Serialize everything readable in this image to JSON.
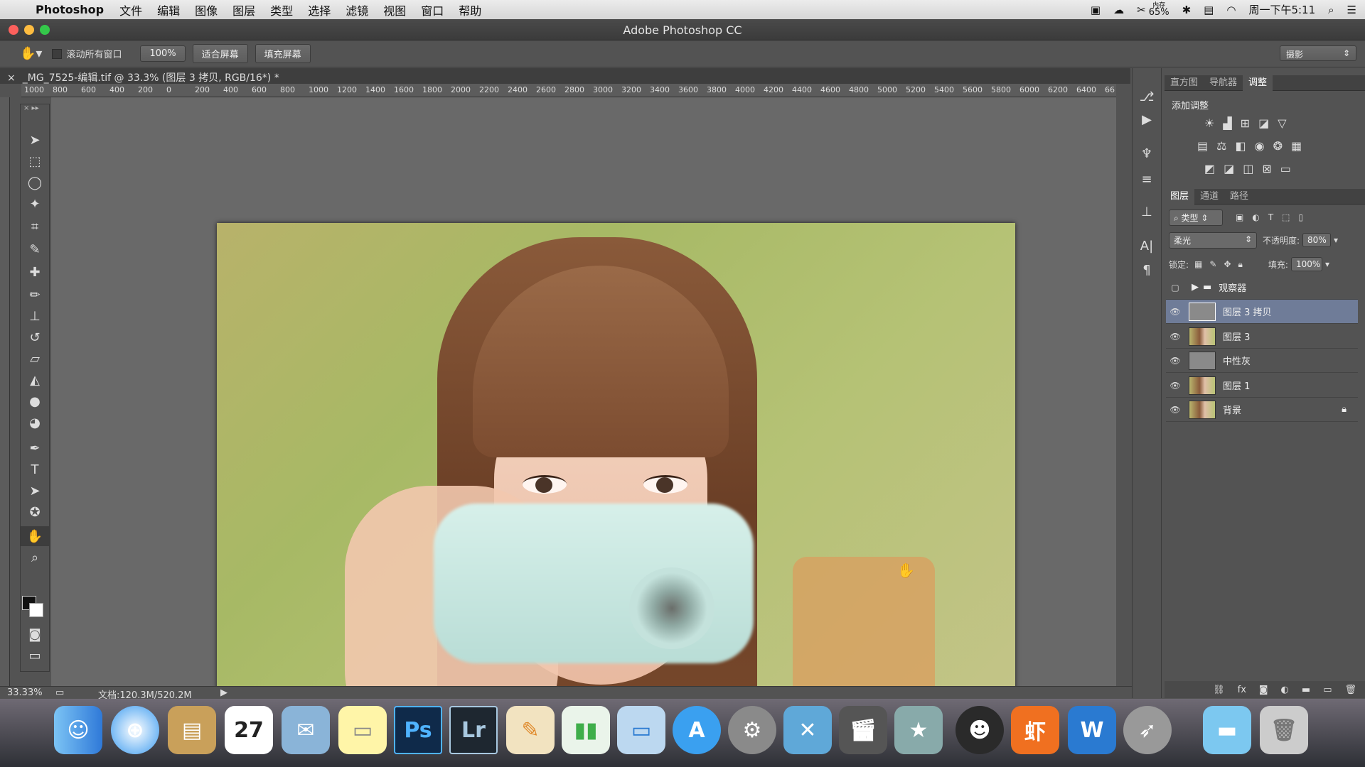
{
  "menubar": {
    "app_name": "Photoshop",
    "menus": [
      "文件",
      "编辑",
      "图像",
      "图层",
      "类型",
      "选择",
      "滤镜",
      "视图",
      "窗口",
      "帮助"
    ],
    "memory_label": "内存",
    "memory_value": "65%",
    "clock": "周一下午5:11"
  },
  "window": {
    "title": "Adobe Photoshop CC"
  },
  "options": {
    "scroll_all": "滚动所有窗口",
    "zoom_100": "100%",
    "fit_screen": "适合屏幕",
    "fill_screen": "填充屏幕",
    "workspace": "摄影"
  },
  "document": {
    "tab_label": "_MG_7525-编辑.tif @ 33.3% (图层 3 拷贝, RGB/16*) *"
  },
  "ruler": {
    "ticks": [
      "1000",
      "800",
      "600",
      "400",
      "200",
      "0",
      "200",
      "400",
      "600",
      "800",
      "1000",
      "1200",
      "1400",
      "1600",
      "1800",
      "2000",
      "2200",
      "2400",
      "2600",
      "2800",
      "3000",
      "3200",
      "3400",
      "3600",
      "3800",
      "4000",
      "4200",
      "4400",
      "4600",
      "4800",
      "5000",
      "5200",
      "5400",
      "5600",
      "5800",
      "6000",
      "6200",
      "6400",
      "66"
    ]
  },
  "status": {
    "zoom": "33.33%",
    "doc_size": "文档:120.3M/520.2M"
  },
  "adjust_panel": {
    "tabs": [
      "直方图",
      "导航器",
      "调整"
    ],
    "active_tab": "调整",
    "add_label": "添加调整"
  },
  "layers_panel": {
    "tabs": [
      "图层",
      "通道",
      "路径"
    ],
    "active_tab": "图层",
    "filter": "类型",
    "blend_mode": "柔光",
    "opacity_label": "不透明度:",
    "opacity_value": "80%",
    "lock_label": "锁定:",
    "fill_label": "填充:",
    "fill_value": "100%",
    "layers": [
      {
        "name": "观察器",
        "type": "group",
        "visible": false,
        "selected": false
      },
      {
        "name": "图层 3 拷贝",
        "type": "gray",
        "visible": true,
        "selected": true
      },
      {
        "name": "图层 3",
        "type": "photo",
        "visible": true,
        "selected": false
      },
      {
        "name": "中性灰",
        "type": "gray",
        "visible": true,
        "selected": false
      },
      {
        "name": "图层 1",
        "type": "photo",
        "visible": true,
        "selected": false
      },
      {
        "name": "背景",
        "type": "photo",
        "visible": true,
        "selected": false,
        "locked": true
      }
    ]
  },
  "dock": {
    "calendar_day": "27",
    "items": [
      "Ps",
      "Lr"
    ]
  },
  "colors": {
    "selected_layer": "#6f7c98",
    "ps_icon": "#0f2a4a",
    "lr_icon": "#1e2730"
  }
}
